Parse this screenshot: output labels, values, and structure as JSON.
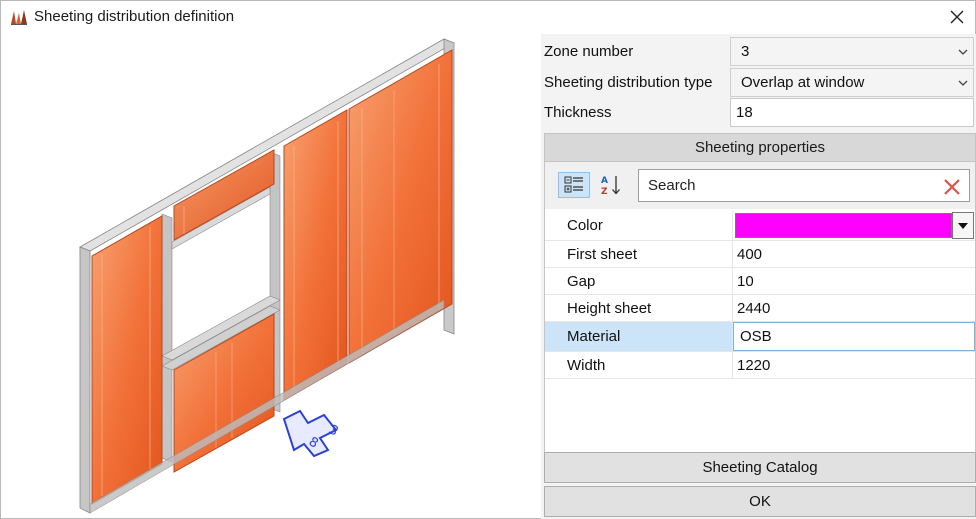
{
  "window": {
    "title": "Sheeting distribution definition",
    "icon": "wall-frame-app-icon",
    "close_icon": "close-icon"
  },
  "fields": {
    "zone_number": {
      "label": "Zone number",
      "value": "3"
    },
    "distribution_type": {
      "label": "Sheeting distribution type",
      "value": "Overlap at window"
    },
    "thickness": {
      "label": "Thickness",
      "value": "18"
    }
  },
  "properties": {
    "header": "Sheeting properties",
    "search_placeholder": "Search",
    "rows": [
      {
        "name": "Color",
        "value": "",
        "swatch": "#ff00ff"
      },
      {
        "name": "First sheet",
        "value": "400"
      },
      {
        "name": "Gap",
        "value": "10"
      },
      {
        "name": "Height sheet",
        "value": "2440"
      },
      {
        "name": "Material",
        "value": "OSB"
      },
      {
        "name": "Width",
        "value": "1220"
      }
    ]
  },
  "buttons": {
    "catalog": "Sheeting Catalog",
    "ok": "OK"
  },
  "colors": {
    "sheet_orange": "#f26a2e",
    "stud_gray": "#c9c9c9",
    "selection_blue": "#cce4f7",
    "swatch_magenta": "#ff00ff"
  }
}
